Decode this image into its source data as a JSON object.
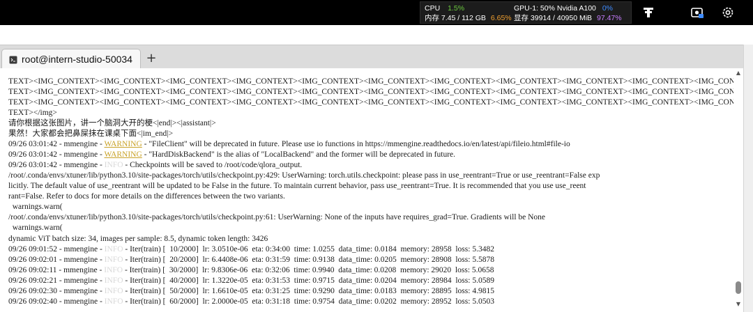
{
  "stats": {
    "cpu_label": "CPU",
    "cpu_value": "1.5%",
    "mem_label": "内存 7.45 / 112 GB",
    "mem_pct": "6.65%",
    "gpu_label": "GPU-1: 50% Nvidia A100",
    "gpu_value": "0%",
    "vram_label": "显存 39914 / 40950 MiB",
    "vram_pct": "97.47%"
  },
  "tabs": [
    {
      "label": "root@intern-studio-50034"
    }
  ],
  "new_tab_label": "+",
  "terminal": {
    "img_line_1": "TEXT><IMG_CONTEXT><IMG_CONTEXT><IMG_CONTEXT><IMG_CONTEXT><IMG_CONTEXT><IMG_CONTEXT><IMG_CONTEXT><IMG_CONTEXT><IMG_CONTEXT><IMG_CONTEXT><IMG_CONTEXT><IMG_CONTEXT><IMG_CON",
    "img_line_2": "TEXT><IMG_CONTEXT><IMG_CONTEXT><IMG_CONTEXT><IMG_CONTEXT><IMG_CONTEXT><IMG_CONTEXT><IMG_CONTEXT><IMG_CONTEXT><IMG_CONTEXT><IMG_CONTEXT><IMG_CONTEXT><IMG_CONTEXT><IMG_CON",
    "img_line_3": "TEXT><IMG_CONTEXT><IMG_CONTEXT><IMG_CONTEXT><IMG_CONTEXT><IMG_CONTEXT><IMG_CONTEXT><IMG_CONTEXT><IMG_CONTEXT><IMG_CONTEXT><IMG_CONTEXT><IMG_CONTEXT><IMG_CONTEXT><IMG_CON",
    "img_line_4": "TEXT></img>",
    "prompt_line": "请你根据这张图片，讲一个脑洞大开的梗<|end|><|assistant|>",
    "answer_line": "果然！大家都会把鼻屎抹在课桌下面<|im_end|>",
    "log1_prefix": "09/26 03:01:42 - mmengine - ",
    "log1_level": "WARNING",
    "log1_msg": " - \"FileClient\" will be deprecated in future. Please use io functions in https://mmengine.readthedocs.io/en/latest/api/fileio.html#file-io",
    "log2_prefix": "09/26 03:01:42 - mmengine - ",
    "log2_level": "WARNING",
    "log2_msg": " - \"HardDiskBackend\" is the alias of \"LocalBackend\" and the former will be deprecated in future.",
    "log3_prefix": "09/26 03:01:42 - mmengine - ",
    "log3_level": "INFO",
    "log3_msg": " - Checkpoints will be saved to /root/code/qlora_output.",
    "uw1_line1": "/root/.conda/envs/xtuner/lib/python3.10/site-packages/torch/utils/checkpoint.py:429: UserWarning: torch.utils.checkpoint: please pass in use_reentrant=True or use_reentrant=False exp",
    "uw1_line2": "licitly. The default value of use_reentrant will be updated to be False in the future. To maintain current behavior, pass use_reentrant=True. It is recommended that you use use_reent",
    "uw1_line3": "rant=False. Refer to docs for more details on the differences between the two variants.",
    "uw1_line4": "  warnings.warn(",
    "uw2_line1": "/root/.conda/envs/xtuner/lib/python3.10/site-packages/torch/utils/checkpoint.py:61: UserWarning: None of the inputs have requires_grad=True. Gradients will be None",
    "uw2_line2": "  warnings.warn(",
    "vit_line": "dynamic ViT batch size: 34, images per sample: 8.5, dynamic token length: 3426",
    "iters": [
      {
        "prefix": "09/26 09:01:52 - mmengine - ",
        "level": "INFO",
        "msg": " - Iter(train) [  10/2000]  lr: 3.0510e-06  eta: 0:34:00  time: 1.0255  data_time: 0.0184  memory: 28958  loss: 5.3482"
      },
      {
        "prefix": "09/26 09:02:01 - mmengine - ",
        "level": "INFO",
        "msg": " - Iter(train) [  20/2000]  lr: 6.4408e-06  eta: 0:31:59  time: 0.9138  data_time: 0.0205  memory: 28908  loss: 5.5878"
      },
      {
        "prefix": "09/26 09:02:11 - mmengine - ",
        "level": "INFO",
        "msg": " - Iter(train) [  30/2000]  lr: 9.8306e-06  eta: 0:32:06  time: 0.9940  data_time: 0.0208  memory: 29020  loss: 5.0658"
      },
      {
        "prefix": "09/26 09:02:21 - mmengine - ",
        "level": "INFO",
        "msg": " - Iter(train) [  40/2000]  lr: 1.3220e-05  eta: 0:31:53  time: 0.9715  data_time: 0.0204  memory: 28984  loss: 5.0589"
      },
      {
        "prefix": "09/26 09:02:30 - mmengine - ",
        "level": "INFO",
        "msg": " - Iter(train) [  50/2000]  lr: 1.6610e-05  eta: 0:31:25  time: 0.9290  data_time: 0.0183  memory: 28895  loss: 4.9815"
      },
      {
        "prefix": "09/26 09:02:40 - mmengine - ",
        "level": "INFO",
        "msg": " - Iter(train) [  60/2000]  lr: 2.0000e-05  eta: 0:31:18  time: 0.9754  data_time: 0.0202  memory: 28952  loss: 5.0503"
      }
    ]
  },
  "icons": {
    "tray_1": "app-logo-icon",
    "tray_2": "screenshot-icon",
    "tray_3": "settings-gear-icon",
    "tab": "terminal-icon"
  }
}
